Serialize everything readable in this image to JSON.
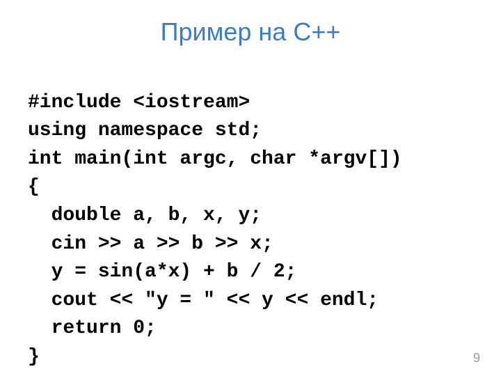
{
  "title": "Пример на С++",
  "code_lines": [
    "#include <iostream>",
    "using namespace std;",
    "int main(int argc, char *argv[])",
    "{",
    "  double a, b, x, y;",
    "  cin >> a >> b >> x;",
    "  y = sin(a*x) + b / 2;",
    "  cout << \"y = \" << y << endl;",
    "  return 0;",
    "}"
  ],
  "page_number": "9"
}
